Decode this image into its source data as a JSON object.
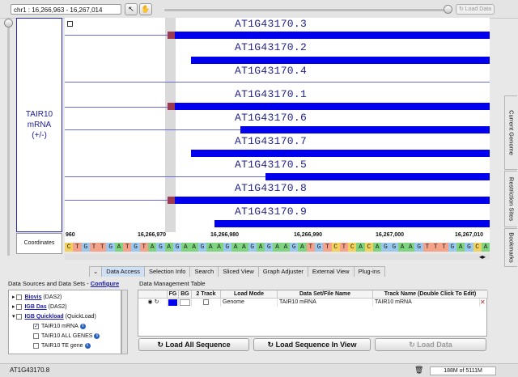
{
  "toolbar": {
    "location": "chr1 : 16,266,963 - 16,267,014",
    "load_data_label": "Load Data"
  },
  "track": {
    "label": "TAIR10 mRNA",
    "strand": "(+/-)",
    "coordinates_label": "Coordinates",
    "transcripts": [
      "AT1G43170.3",
      "AT1G43170.2",
      "AT1G43170.4",
      "AT1G43170.1",
      "AT1G43170.6",
      "AT1G43170.7",
      "AT1G43170.5",
      "AT1G43170.8",
      "AT1G43170.9"
    ]
  },
  "ruler": {
    "ticks": [
      "960",
      "16,266,970",
      "16,266,980",
      "16,266,990",
      "16,267,000",
      "16,267,010"
    ]
  },
  "sequence": [
    "C",
    "T",
    "G",
    "T",
    "T",
    "G",
    "A",
    "T",
    "G",
    "T",
    "A",
    "G",
    "A",
    "G",
    "A",
    "A",
    "G",
    "A",
    "A",
    "G",
    "A",
    "A",
    "G",
    "A",
    "G",
    "A",
    "A",
    "G",
    "A",
    "T",
    "G",
    "T",
    "C",
    "T",
    "C",
    "A",
    "C",
    "A",
    "G",
    "G",
    "A",
    "A",
    "G",
    "T",
    "T",
    "T",
    "G",
    "A",
    "G",
    "C",
    "A"
  ],
  "right_tabs": [
    "Current Genome",
    "Restriction Sites",
    "Bookmarks"
  ],
  "tabs": [
    "Data Access",
    "Selection Info",
    "Search",
    "Sliced View",
    "Graph Adjuster",
    "External View",
    "Plug-ins"
  ],
  "data_sources": {
    "title": "Data Sources and Data Sets - ",
    "configure": "Configure",
    "items": [
      {
        "name": "Biovis",
        "suffix": " (DAS2)"
      },
      {
        "name": "IGB Das",
        "suffix": " (DAS2)"
      },
      {
        "name": "IGB Quickload",
        "suffix": " (QuickLoad)"
      }
    ],
    "datasets": [
      "TAIR10 mRNA",
      "TAIR10 ALL GENES",
      "TAIR10 TE gene"
    ]
  },
  "data_management": {
    "title": "Data Management Table",
    "columns": [
      "FG",
      "BG",
      "2 Track",
      "Load Mode",
      "Data Set/File Name",
      "Track Name (Double Click To Edit)"
    ],
    "row": {
      "load_mode": "Genome",
      "dataset": "TAIR10 mRNA",
      "track_name": "TAIR10 mRNA"
    }
  },
  "buttons": {
    "load_all_sequence": "Load All Sequence",
    "load_sequence_in_view": "Load Sequence In View",
    "load_data": "Load Data"
  },
  "status": {
    "selection": "AT1G43170.8",
    "memory": "188M of 5111M"
  },
  "colors": {
    "feature": "#0000ee",
    "utr": "#9b3a52",
    "separator": "#6a6ad8"
  }
}
